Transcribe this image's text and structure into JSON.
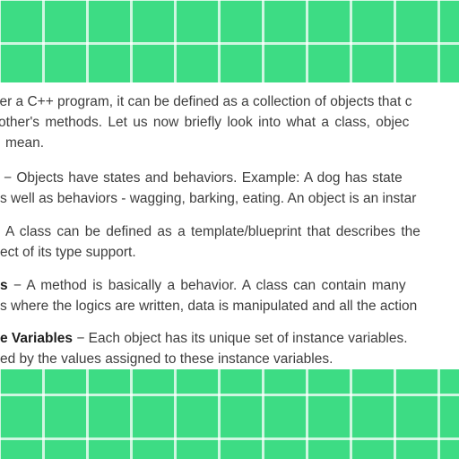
{
  "article": {
    "intro": {
      "lines": [
        "ler a C++ program, it can be defined as a collection of objects that c",
        "other's methods. Let us now briefly look into what a class, objec",
        "mean."
      ]
    },
    "objects": {
      "term": "",
      "lines": [
        "− Objects have states and behaviors. Example: A dog has state",
        "s well as behaviors - wagging, barking, eating. An object is an instar"
      ]
    },
    "class": {
      "term": "",
      "lines": [
        "A class can be defined as a template/blueprint that describes the",
        "ect of its type support."
      ]
    },
    "methods": {
      "term": "s",
      "lines": [
        " − A method is basically a behavior. A class can contain many",
        "s where the logics are written, data is manipulated and all the action"
      ]
    },
    "instance_variables": {
      "term": "e Variables",
      "lines": [
        " − Each object has its unique set of instance variables.",
        "ed by the values assigned to these instance variables."
      ]
    }
  }
}
